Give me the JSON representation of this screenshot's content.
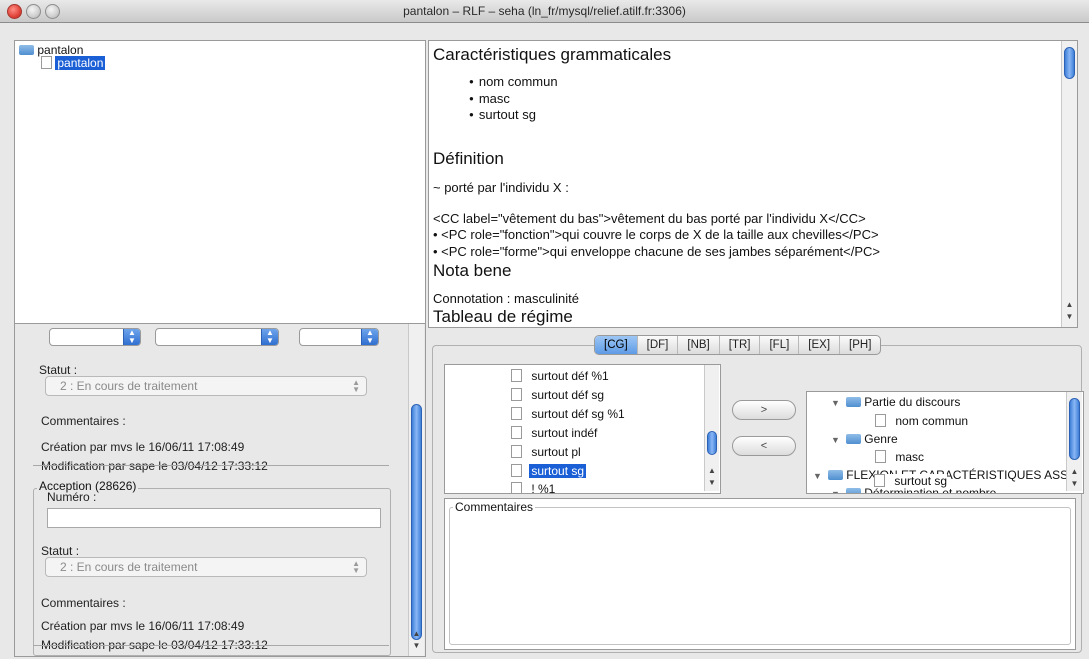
{
  "window": {
    "title": "pantalon – RLF – seha (ln_fr/mysql/relief.atilf.fr:3306)"
  },
  "tree": {
    "root_label": "pantalon",
    "child_label": "pantalon"
  },
  "form": {
    "statut_label": "Statut :",
    "statut_value": "2 : En cours de traitement",
    "commentaires_label": "Commentaires :",
    "creation_text": "Création par mvs le 16/06/11 17:08:49",
    "modification_text": "Modification par sape le 03/04/12 17:33:12",
    "acception_legend": "Acception (28626)",
    "numero_label": "Numéro :",
    "statut2_label": "Statut :",
    "statut2_value": "2 : En cours de traitement",
    "commentaires2_label": "Commentaires :",
    "creation2_text": "Création par mvs le 16/06/11 17:08:49",
    "modification2_text": "Modification par sape le 03/04/12 17:33:12"
  },
  "article": {
    "cg_heading": "Caractéristiques grammaticales",
    "cg_items": [
      "nom commun",
      "masc",
      "surtout sg"
    ],
    "def_heading": "Définition",
    "def_line1": "~ porté par l'individu X :",
    "def_cc": "<CC label=\"vêtement du bas\">vêtement du bas porté par l'individu X</CC>",
    "def_pc1": "• <PC role=\"fonction\">qui couvre le corps de X de la taille aux chevilles</PC>",
    "def_pc2": "• <PC role=\"forme\">qui enveloppe chacune de ses jambes séparément</PC>",
    "nb_heading": "Nota bene",
    "nb_line": "Connotation : masculinité",
    "tr_heading": "Tableau de régime"
  },
  "tabs": [
    "[CG]",
    "[DF]",
    "[NB]",
    "[TR]",
    "[FL]",
    "[EX]",
    "[PH]"
  ],
  "left_list": [
    "surtout déf %1",
    "surtout déf sg",
    "surtout déf sg %1",
    "surtout indéf",
    "surtout pl",
    "surtout sg",
    "! %1"
  ],
  "selected_left_item": "surtout sg",
  "buttons": {
    "add": ">",
    "remove": "<"
  },
  "right_tree": {
    "n1": "Partie du discours",
    "n1a": "nom commun",
    "n2": "Genre",
    "n2a": "masc",
    "n3": "FLEXION ET CARACTÉRISTIQUES ASS",
    "n3a": "Détermination et nombre",
    "n3b": "surtout sg"
  },
  "comment_legend": "Commentaires",
  "colors": {
    "selection": "#1a5fd6",
    "scroll_thumb": "#3f7fd8"
  }
}
